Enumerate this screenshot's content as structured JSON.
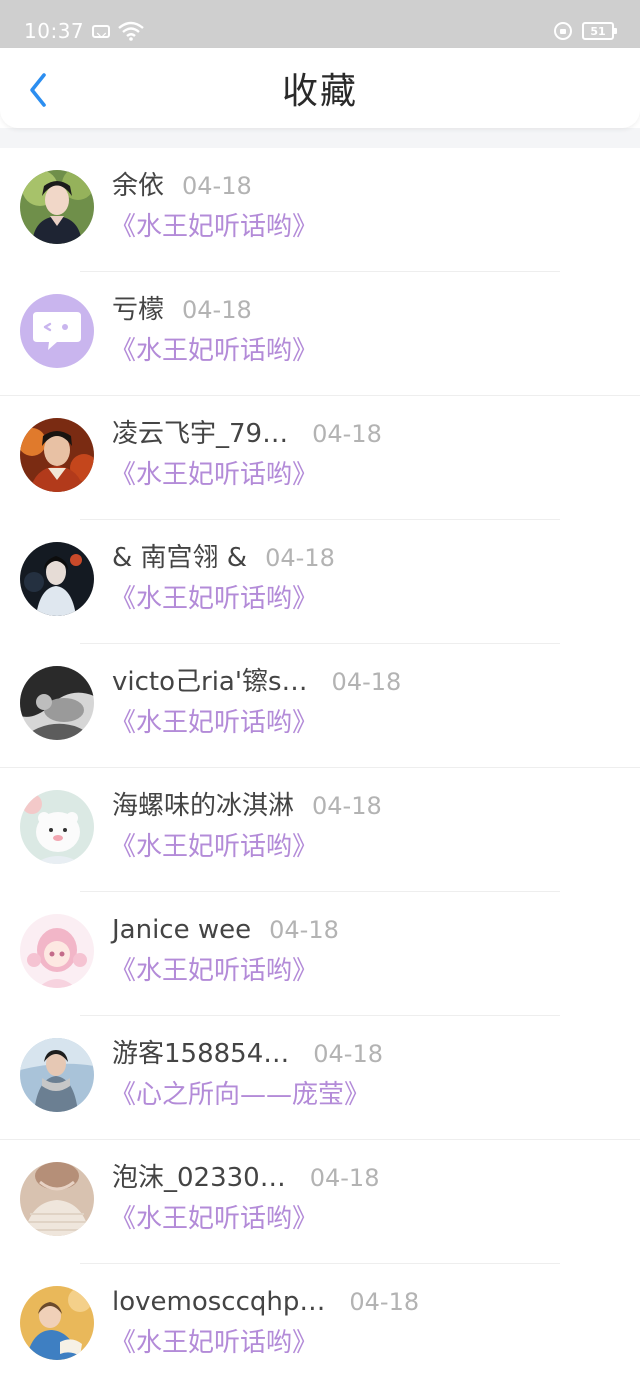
{
  "status_bar": {
    "time": "10:37",
    "battery": "51"
  },
  "header": {
    "title": "收藏"
  },
  "colors": {
    "accent_purple": "#b38bd8",
    "back_arrow": "#2c8ef0",
    "date_gray": "#b3b3b3",
    "name_gray": "#444444"
  },
  "favorites": [
    {
      "name": "余依",
      "date": "04-18",
      "book": "《水王妃听话哟》",
      "avatar": "photo-avatar"
    },
    {
      "name": "亏檬",
      "date": "04-18",
      "book": "《水王妃听话哟》",
      "avatar": "default-chat-avatar"
    },
    {
      "name": "凌云飞宇_79…",
      "date": "04-18",
      "book": "《水王妃听话哟》",
      "avatar": "photo-avatar"
    },
    {
      "name": "& 南宫翎 &",
      "date": "04-18",
      "book": "《水王妃听话哟》",
      "avatar": "photo-avatar"
    },
    {
      "name": "victo己ria'镲s…",
      "date": "04-18",
      "book": "《水王妃听话哟》",
      "avatar": "photo-avatar"
    },
    {
      "name": "海螺味的冰淇淋",
      "date": "04-18",
      "book": "《水王妃听话哟》",
      "avatar": "cartoon-avatar"
    },
    {
      "name": "Janice wee",
      "date": "04-18",
      "book": "《水王妃听话哟》",
      "avatar": "anime-avatar"
    },
    {
      "name": "游客158854…",
      "date": "04-18",
      "book": "《心之所向——庞莹》",
      "avatar": "photo-avatar"
    },
    {
      "name": "泡沫_02330…",
      "date": "04-18",
      "book": "《水王妃听话哟》",
      "avatar": "photo-avatar"
    },
    {
      "name": "lovemosccqhp…",
      "date": "04-18",
      "book": "《水王妃听话哟》",
      "avatar": "photo-avatar"
    }
  ]
}
